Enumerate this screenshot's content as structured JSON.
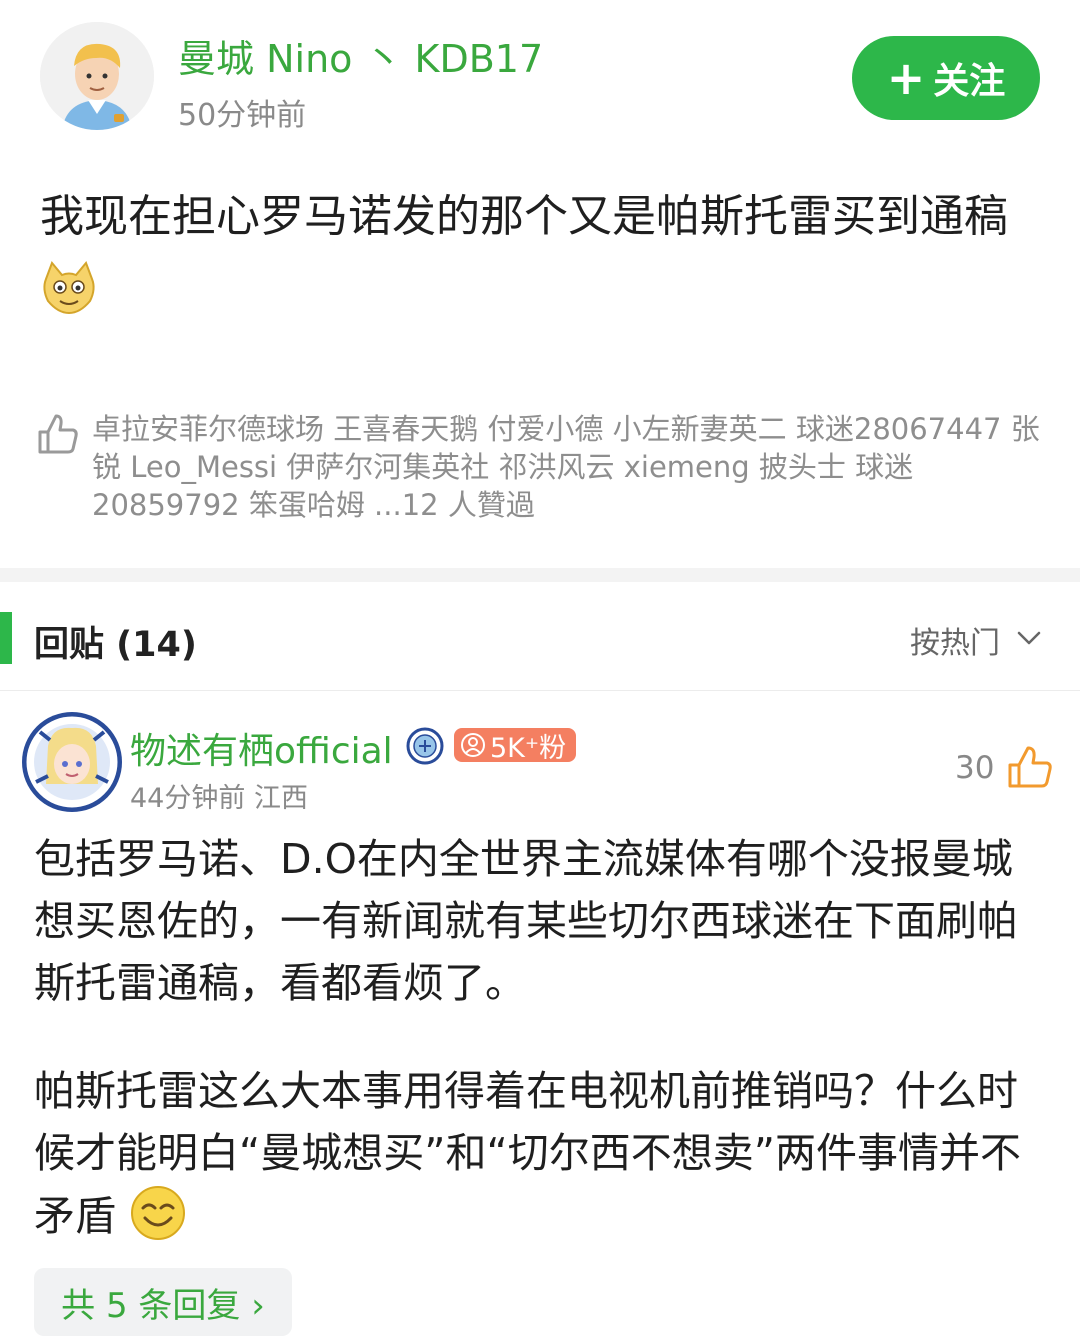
{
  "post": {
    "author_name": "曼城 Nino 丶 KDB17",
    "time": "50分钟前",
    "follow_label": "关注",
    "body": "我现在担心罗马诺发的那个又是帕斯托雷买到通稿"
  },
  "likes": {
    "text": "卓拉安菲尔德球场 王喜春天鹅 付爱小德 小左新妻英二 球迷28067447 张锐 Leo_Messi 伊萨尔河集英社 祁洪风云 xiemeng 披头士 球迷20859792 笨蛋哈姆 ...12 人贊過"
  },
  "replies_section": {
    "title": "回贴 (14)",
    "sort_label": "按热门"
  },
  "comment": {
    "name": "物述有栖official",
    "fans_badge": "5K⁺粉",
    "time": "44分钟前",
    "location": "江西",
    "like_count": "30",
    "para1": "包括罗马诺、D.O在内全世界主流媒体有哪个没报曼城想买恩佐的，一有新闻就有某些切尔西球迷在下面刷帕斯托雷通稿，看都看烦了。",
    "para2": "帕斯托雷这么大本事用得着在电视机前推销吗？什么时候才能明白“曼城想买”和“切尔西不想卖”两件事情并不矛盾",
    "replies_link": "共 5 条回复 ›"
  },
  "colors": {
    "brand_green": "#2db74a",
    "name_green": "#3aa83e",
    "fans_badge": "#f47f61",
    "like_orange": "#f29a2e"
  },
  "icons": [
    "avatar",
    "emoji-face-icon",
    "thumbs-up-icon",
    "chevron-down-icon",
    "man-city-badge-icon",
    "person-icon",
    "smile-emoji-icon"
  ]
}
